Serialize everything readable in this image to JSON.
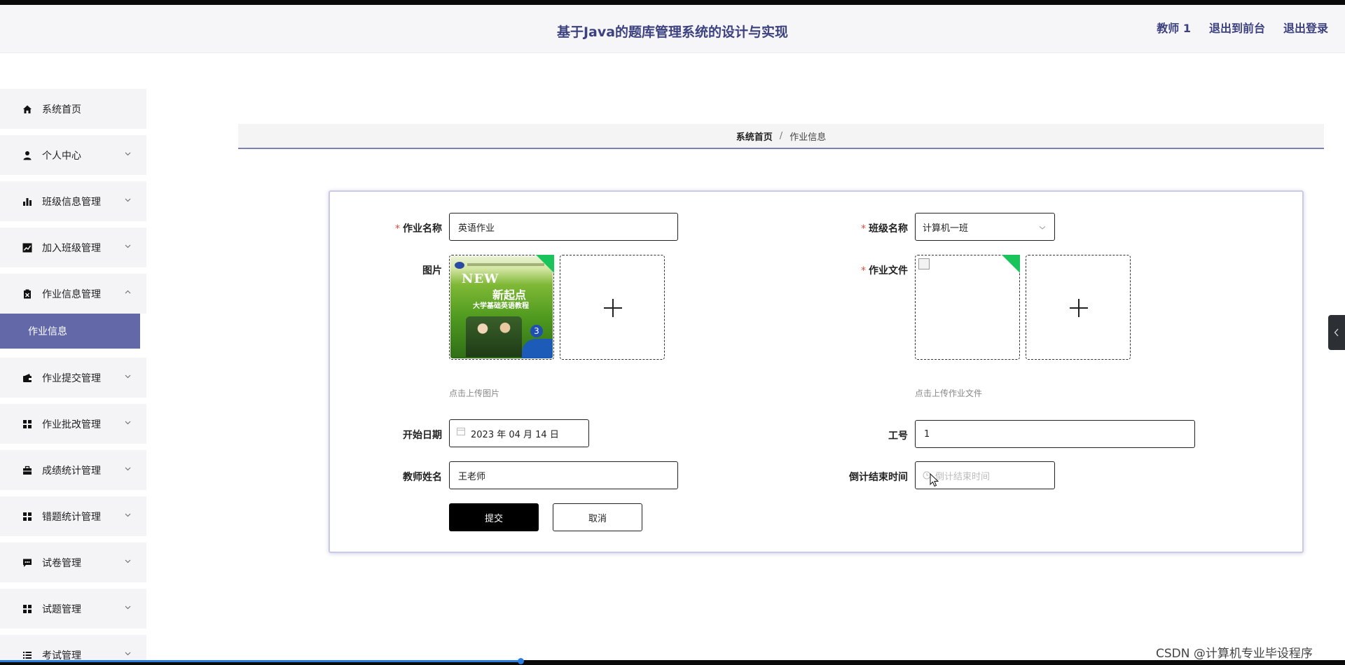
{
  "header": {
    "title": "基于Java的题库管理系统的设计与实现",
    "actions": [
      "教师 1",
      "退出到前台",
      "退出登录"
    ]
  },
  "sidebar": {
    "items": [
      {
        "label": "系统首页",
        "icon": "home-icon",
        "has_chevron": false
      },
      {
        "label": "个人中心",
        "icon": "user-icon",
        "has_chevron": true
      },
      {
        "label": "班级信息管理",
        "icon": "bar-chart-icon",
        "has_chevron": true
      },
      {
        "label": "加入班级管理",
        "icon": "line-chart-icon",
        "has_chevron": true
      },
      {
        "label": "作业信息管理",
        "icon": "clipboard-icon",
        "has_chevron": true,
        "expanded": true
      },
      {
        "label": "作业提交管理",
        "icon": "wallet-icon",
        "has_chevron": true
      },
      {
        "label": "作业批改管理",
        "icon": "grid-icon",
        "has_chevron": true
      },
      {
        "label": "成绩统计管理",
        "icon": "briefcase-icon",
        "has_chevron": true
      },
      {
        "label": "错题统计管理",
        "icon": "grid-icon",
        "has_chevron": true
      },
      {
        "label": "试卷管理",
        "icon": "chat-icon",
        "has_chevron": true
      },
      {
        "label": "试题管理",
        "icon": "grid-icon",
        "has_chevron": true
      },
      {
        "label": "考试管理",
        "icon": "list-icon",
        "has_chevron": true
      }
    ],
    "active_sub": "作业信息"
  },
  "breadcrumb": {
    "home": "系统首页",
    "separator": "/",
    "current": "作业信息"
  },
  "form": {
    "homework_name": {
      "label": "作业名称",
      "required": true,
      "value": "英语作业"
    },
    "class_name": {
      "label": "班级名称",
      "required": true,
      "value": "计算机一班"
    },
    "image": {
      "label": "图片",
      "required": false,
      "hint": "点击上传图片"
    },
    "homework_file": {
      "label": "作业文件",
      "required": true,
      "hint": "点击上传作业文件"
    },
    "start_date": {
      "label": "开始日期",
      "value": "2023 年 04 月 14 日"
    },
    "staff_id": {
      "label": "工号",
      "value": "1"
    },
    "teacher_name": {
      "label": "教师姓名",
      "value": "王老师"
    },
    "countdown_end": {
      "label": "倒计结束时间",
      "placeholder": "倒计结束时间"
    },
    "required_mark": "*",
    "submit_label": "提交",
    "cancel_label": "取消"
  },
  "book_cover": {
    "brand": "NEW",
    "title": "新起点",
    "subtitle": "大学基础英语教程",
    "volume": "3"
  },
  "watermark": "CSDN @计算机专业毕设程序",
  "colors": {
    "accent": "#6369a8",
    "header_text": "#3c4180",
    "required": "#e64a3c",
    "corner_badge": "#19c45b"
  }
}
